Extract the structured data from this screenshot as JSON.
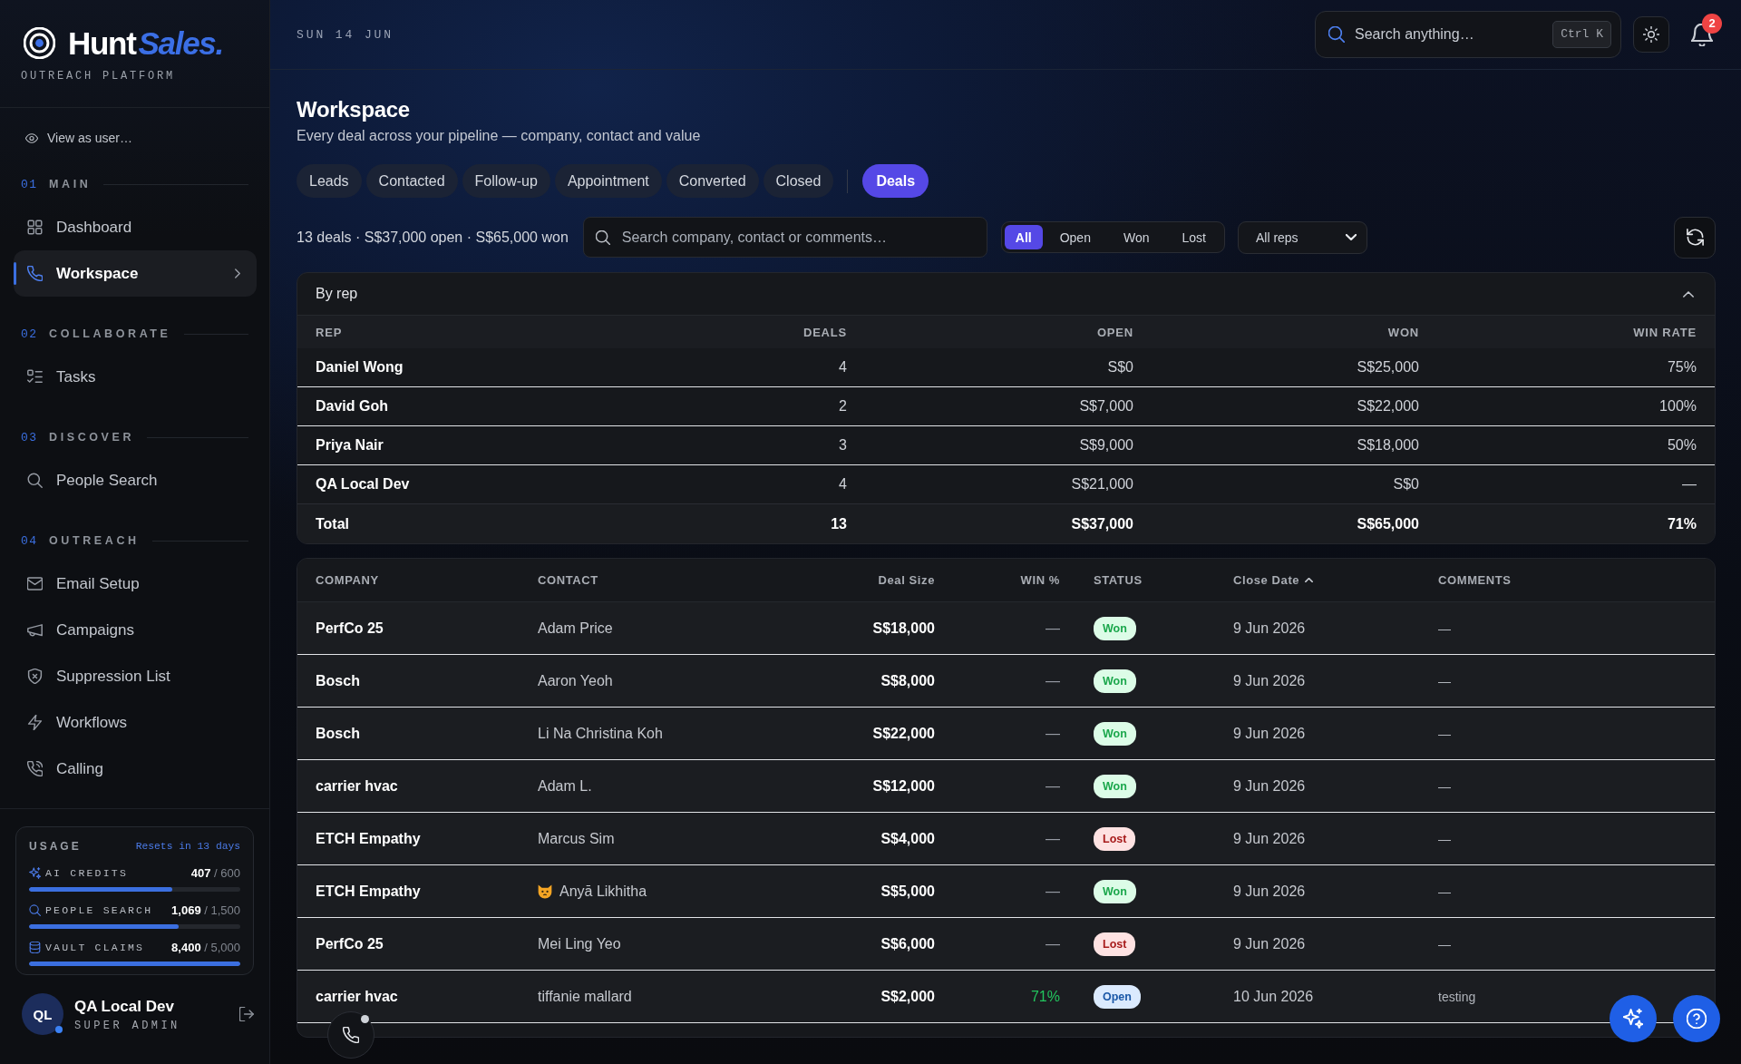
{
  "sidebar": {
    "brand": {
      "first": "Hunt",
      "second": "Sales.",
      "tagline": "OUTREACH PLATFORM"
    },
    "view_as": "View as user…",
    "sections": [
      {
        "number": "01",
        "title": "MAIN",
        "items": [
          {
            "label": "Dashboard",
            "selected": false
          },
          {
            "label": "Workspace",
            "selected": true
          }
        ]
      },
      {
        "number": "02",
        "title": "COLLABORATE",
        "items": [
          {
            "label": "Tasks",
            "selected": false
          }
        ]
      },
      {
        "number": "03",
        "title": "DISCOVER",
        "items": [
          {
            "label": "People Search",
            "selected": false
          }
        ]
      },
      {
        "number": "04",
        "title": "OUTREACH",
        "items": [
          {
            "label": "Email Setup",
            "selected": false
          },
          {
            "label": "Campaigns",
            "selected": false
          },
          {
            "label": "Suppression List",
            "selected": false
          },
          {
            "label": "Workflows",
            "selected": false
          },
          {
            "label": "Calling",
            "selected": false
          }
        ]
      }
    ],
    "usage": {
      "title": "USAGE",
      "resets": "Resets in 13 days",
      "meters": [
        {
          "label": "AI CREDITS",
          "value": "**407** / 600",
          "level": 0.68
        },
        {
          "label": "PEOPLE SEARCH",
          "value": "**1,069** / 1,500",
          "level": 0.71
        },
        {
          "label": "VAULT CLAIMS",
          "value": "**8,400** / 5,000",
          "level": 1
        }
      ]
    },
    "user": {
      "initials": "QL",
      "name": "QA Local Dev",
      "role": "SUPER ADMIN",
      "online": true
    }
  },
  "header": {
    "date": "SUN 14 JUN",
    "search": {
      "placeholder": "Search anything…",
      "shortcut": "Ctrl K"
    },
    "notification_count": "2"
  },
  "page": {
    "title": "Workspace",
    "subtitle": "Every deal across your pipeline — company, contact and value"
  },
  "stage_tabs": [
    {
      "label": "Leads",
      "selected": false
    },
    {
      "label": "Contacted",
      "selected": false
    },
    {
      "label": "Follow-up",
      "selected": false
    },
    {
      "label": "Appointment",
      "selected": false
    },
    {
      "label": "Converted",
      "selected": false
    },
    {
      "label": "Closed",
      "selected": false
    }
  ],
  "view_tabs": [
    {
      "label": "Deals",
      "selected": true
    }
  ],
  "toolbar": {
    "summary": "13 deals · S$37,000 open · S$65,000 won",
    "search": {
      "placeholder": "Search company, contact or comments…"
    },
    "status_filter": [
      {
        "label": "All",
        "selected": true
      },
      {
        "label": "Open",
        "selected": false
      },
      {
        "label": "Won",
        "selected": false
      },
      {
        "label": "Lost",
        "selected": false
      }
    ],
    "rep_select": {
      "value": "All reps"
    }
  },
  "by_rep": {
    "title": "By rep",
    "expanded": true,
    "columns": [
      "REP",
      "DEALS",
      "OPEN",
      "WON",
      "WIN RATE"
    ],
    "rows": [
      {
        "rep": "Daniel Wong",
        "deals": "4",
        "open": "S$0",
        "won": "S$25,000",
        "win_rate": "75%"
      },
      {
        "rep": "David Goh",
        "deals": "2",
        "open": "S$7,000",
        "won": "S$22,000",
        "win_rate": "100%"
      },
      {
        "rep": "Priya Nair",
        "deals": "3",
        "open": "S$9,000",
        "won": "S$18,000",
        "win_rate": "50%"
      },
      {
        "rep": "QA Local Dev",
        "deals": "4",
        "open": "S$21,000",
        "won": "S$0",
        "win_rate": "—"
      }
    ],
    "total": {
      "rep": "Total",
      "deals": "13",
      "open": "S$37,000",
      "won": "S$65,000",
      "win_rate": "71%"
    }
  },
  "deals": {
    "columns": [
      {
        "label": "COMPANY",
        "sorted": false
      },
      {
        "label": "CONTACT",
        "sorted": false
      },
      {
        "label": "Deal Size",
        "sorted": false
      },
      {
        "label": "WIN %",
        "sorted": false
      },
      {
        "label": "STATUS",
        "sorted": false
      },
      {
        "label": "Close Date",
        "sorted": true
      },
      {
        "label": "COMMENTS",
        "sorted": false
      }
    ],
    "rows": [
      {
        "company": "PerfCo 25",
        "contact": "Adam Price",
        "contact_emoji": false,
        "deal_size": "S$18,000",
        "win_pct": "—",
        "win_pct_positive": false,
        "status": {
          "label": "Won",
          "color": "#dcfce7"
        },
        "close_date": "9 Jun 2026",
        "comments": "—"
      },
      {
        "company": "Bosch",
        "contact": "Aaron Yeoh",
        "contact_emoji": false,
        "deal_size": "S$8,000",
        "win_pct": "—",
        "win_pct_positive": false,
        "status": {
          "label": "Won",
          "color": "#dcfce7"
        },
        "close_date": "9 Jun 2026",
        "comments": "—"
      },
      {
        "company": "Bosch",
        "contact": "Li Na Christina Koh",
        "contact_emoji": false,
        "deal_size": "S$22,000",
        "win_pct": "—",
        "win_pct_positive": false,
        "status": {
          "label": "Won",
          "color": "#dcfce7"
        },
        "close_date": "9 Jun 2026",
        "comments": "—"
      },
      {
        "company": "carrier hvac",
        "contact": "Adam L.",
        "contact_emoji": false,
        "deal_size": "S$12,000",
        "win_pct": "—",
        "win_pct_positive": false,
        "status": {
          "label": "Won",
          "color": "#dcfce7"
        },
        "close_date": "9 Jun 2026",
        "comments": "—"
      },
      {
        "company": "ETCH Empathy",
        "contact": "Marcus Sim",
        "contact_emoji": false,
        "deal_size": "S$4,000",
        "win_pct": "—",
        "win_pct_positive": false,
        "status": {
          "label": "Lost",
          "color": "#fee2e2"
        },
        "close_date": "9 Jun 2026",
        "comments": "—"
      },
      {
        "company": "ETCH Empathy",
        "contact": "Anyā Likhitha",
        "contact_emoji": true,
        "deal_size": "S$5,000",
        "win_pct": "—",
        "win_pct_positive": false,
        "status": {
          "label": "Won",
          "color": "#dcfce7"
        },
        "close_date": "9 Jun 2026",
        "comments": "—"
      },
      {
        "company": "PerfCo 25",
        "contact": "Mei Ling Yeo",
        "contact_emoji": false,
        "deal_size": "S$6,000",
        "win_pct": "—",
        "win_pct_positive": false,
        "status": {
          "label": "Lost",
          "color": "#fee2e2"
        },
        "close_date": "9 Jun 2026",
        "comments": "—"
      },
      {
        "company": "carrier hvac",
        "contact": "tiffanie mallard",
        "contact_emoji": false,
        "deal_size": "S$2,000",
        "win_pct": "71%",
        "win_pct_positive": true,
        "status": {
          "label": "Open",
          "color": "#dbeafe"
        },
        "close_date": "10 Jun 2026",
        "comments": "testing"
      }
    ]
  }
}
